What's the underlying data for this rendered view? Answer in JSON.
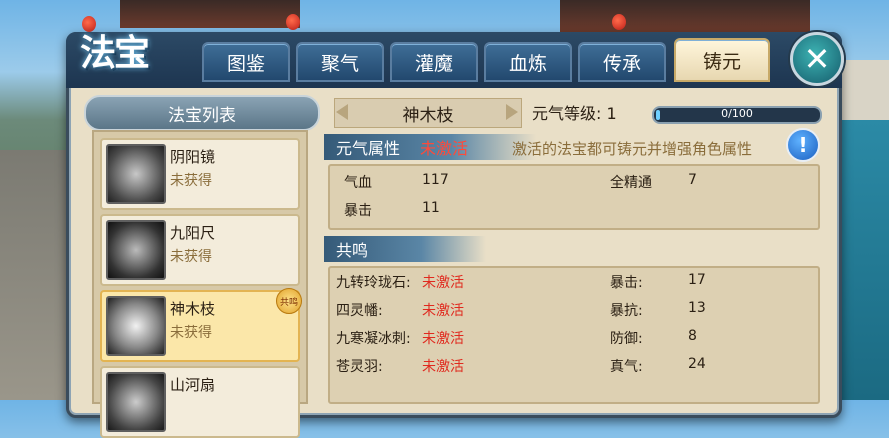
{
  "title": "法宝",
  "tabs": [
    "图鉴",
    "聚气",
    "灌魔",
    "血炼",
    "传承",
    "铸元"
  ],
  "active_tab": "铸元",
  "list": {
    "header": "法宝列表",
    "items": [
      {
        "name": "阴阳镜",
        "status": "未获得"
      },
      {
        "name": "九阳尺",
        "status": "未获得"
      },
      {
        "name": "神木枝",
        "status": "未获得",
        "badge": "共鸣"
      },
      {
        "name": "山河扇",
        "status": ""
      }
    ]
  },
  "detail": {
    "name": "神木枝",
    "level_label": "元气等级: 1",
    "progress_text": "0/100",
    "progress": 0,
    "attr_section": {
      "title": "元气属性",
      "state": "未激活",
      "hint": "激活的法宝都可铸元并增强角色属性"
    },
    "attrs": [
      {
        "label": "气血",
        "value": "117"
      },
      {
        "label": "全精通",
        "value": "7"
      },
      {
        "label": "暴击",
        "value": "11"
      }
    ],
    "resonance_section": {
      "title": "共鸣"
    },
    "resonance": [
      {
        "label": "九转玲珑石:",
        "state": "未激活"
      },
      {
        "label": "四灵幡:",
        "state": "未激活"
      },
      {
        "label": "九寒凝冰刺:",
        "state": "未激活"
      },
      {
        "label": "苍灵羽:",
        "state": "未激活"
      }
    ],
    "resonance_stats": [
      {
        "label": "暴击:",
        "value": "17"
      },
      {
        "label": "暴抗:",
        "value": "13"
      },
      {
        "label": "防御:",
        "value": "8"
      },
      {
        "label": "真气:",
        "value": "24"
      }
    ]
  },
  "colors": {
    "inactive": "#e02a1f",
    "accent": "#6fd0ff"
  }
}
